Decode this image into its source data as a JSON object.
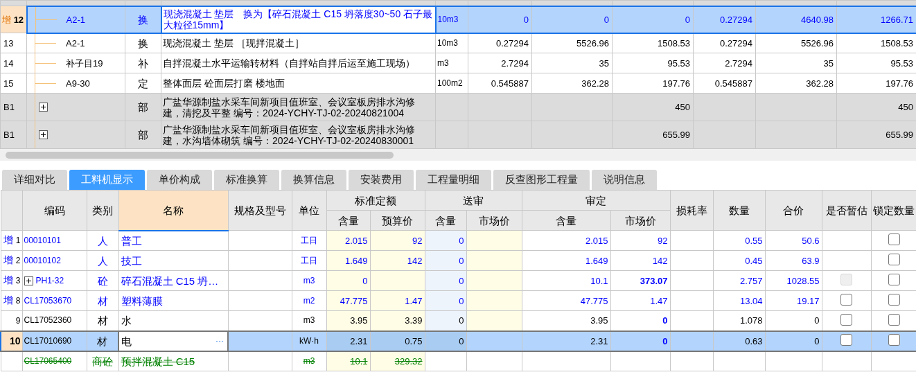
{
  "top_table": {
    "rows": [
      {
        "tag": "增",
        "num": "12",
        "kind": "item",
        "code": "A2-1",
        "type": "换",
        "name": "现浇混凝土 垫层　换为【碎石混凝土 C15 坍落度30~50 石子最大粒径15mm】",
        "unit": "10m3",
        "values": {
          "c1": "0",
          "c2": "0",
          "c3": "0",
          "c4": "0.27294",
          "c5": "4640.98",
          "c6": "1266.71"
        },
        "selected": true
      },
      {
        "num": "13",
        "kind": "item",
        "code": "A2-1",
        "type": "换",
        "name": "现浇混凝土 垫层 ［现拌混凝土］",
        "unit": "10m3",
        "values": {
          "c1": "0.27294",
          "c2": "5526.96",
          "c3": "1508.53",
          "c4": "0.27294",
          "c5": "5526.96",
          "c6": "1508.53"
        },
        "selected": false
      },
      {
        "num": "14",
        "kind": "item",
        "code": "补子目19",
        "type": "补",
        "name": "自拌混凝土水平运输转材料（自拌站自拌后运至施工现场）",
        "unit": "m3",
        "values": {
          "c1": "2.7294",
          "c2": "35",
          "c3": "95.53",
          "c4": "2.7294",
          "c5": "35",
          "c6": "95.53"
        },
        "selected": false
      },
      {
        "num": "15",
        "kind": "item",
        "code": "A9-30",
        "type": "定",
        "name": "整体面层 砼面层打磨 楼地面",
        "unit": "100m2",
        "values": {
          "c1": "0.545887",
          "c2": "362.28",
          "c3": "197.76",
          "c4": "0.545887",
          "c5": "362.28",
          "c6": "197.76"
        },
        "selected": false
      },
      {
        "num": "B1",
        "kind": "section",
        "type": "部",
        "name": "广盐华源制盐水采车间新项目值班室、会议室板房排水沟修建，清挖及平整 编号：2024-YCHY-TJ-02-20240821004",
        "values": {
          "c3": "450",
          "c6": "450"
        },
        "selected": false
      },
      {
        "num": "B1",
        "kind": "section",
        "type": "部",
        "name": "广盐华源制盐水采车间新项目值班室、会议室板房排水沟修建，水沟墙体砌筑 编号：2024-YCHY-TJ-02-20240830001",
        "values": {
          "c3": "655.99",
          "c6": "655.99"
        },
        "selected": false
      }
    ]
  },
  "tabs": [
    {
      "label": "详细对比",
      "selected": false
    },
    {
      "label": "工料机显示",
      "selected": true
    },
    {
      "label": "单价构成",
      "selected": false
    },
    {
      "label": "标准换算",
      "selected": false
    },
    {
      "label": "换算信息",
      "selected": false
    },
    {
      "label": "安装费用",
      "selected": false
    },
    {
      "label": "工程量明细",
      "selected": false
    },
    {
      "label": "反查图形工程量",
      "selected": false
    },
    {
      "label": "说明信息",
      "selected": false
    }
  ],
  "resource_table": {
    "columns": [
      {
        "label": "编码",
        "selected": false
      },
      {
        "label": "类别",
        "selected": false
      },
      {
        "label": "名称",
        "selected": true
      },
      {
        "label": "规格及型号",
        "selected": false
      },
      {
        "label": "单位",
        "selected": false
      },
      {
        "label": "标准定额",
        "selected": false,
        "children": [
          "含量",
          "预算价"
        ]
      },
      {
        "label": "送审",
        "selected": false,
        "children": [
          "含量",
          "市场价"
        ]
      },
      {
        "label": "审定",
        "selected": false,
        "children": [
          "含量",
          "市场价"
        ]
      },
      {
        "label": "损耗率",
        "selected": false
      },
      {
        "label": "数量",
        "selected": false
      },
      {
        "label": "合价",
        "selected": false
      },
      {
        "label": "是否暂估",
        "selected": false
      },
      {
        "label": "锁定数量",
        "selected": false
      }
    ],
    "rows": [
      {
        "kind": "added",
        "tag": "增",
        "num": "1",
        "code": "00010101",
        "expandable": false,
        "type": "人",
        "name": "普工",
        "unit": "工日",
        "std_qty": "2.015",
        "std_price": "92",
        "sub_qty": "0",
        "aud_qty": "2.015",
        "aud_price": "92",
        "price_changed": false,
        "qty": "0.55",
        "total": "50.6",
        "locked": {
          "checked": false
        },
        "selected": false
      },
      {
        "kind": "added",
        "tag": "增",
        "num": "2",
        "code": "00010102",
        "expandable": false,
        "type": "人",
        "name": "技工",
        "unit": "工日",
        "std_qty": "1.649",
        "std_price": "142",
        "sub_qty": "0",
        "aud_qty": "1.649",
        "aud_price": "142",
        "price_changed": false,
        "qty": "0.45",
        "total": "63.9",
        "locked": {
          "checked": false
        },
        "selected": false
      },
      {
        "kind": "added",
        "tag": "增",
        "num": "3",
        "code": "PH1-32",
        "expandable": true,
        "type": "砼",
        "name": "碎石混凝土 C15 坍…",
        "unit": "m3",
        "std_qty": "0",
        "sub_qty": "0",
        "aud_qty": "10.1",
        "aud_price": "373.07",
        "price_changed": true,
        "qty": "2.757",
        "total": "1028.55",
        "estimate": {
          "checked": false,
          "disabled": true
        },
        "locked": {
          "checked": false
        },
        "selected": false
      },
      {
        "kind": "added",
        "tag": "增",
        "num": "8",
        "code": "CL17053670",
        "expandable": false,
        "type": "材",
        "name": "塑料薄膜",
        "unit": "m2",
        "std_qty": "47.775",
        "std_price": "1.47",
        "sub_qty": "0",
        "aud_qty": "47.775",
        "aud_price": "1.47",
        "price_changed": false,
        "qty": "13.04",
        "total": "19.17",
        "estimate": {
          "checked": false,
          "disabled": false
        },
        "locked": {
          "checked": false
        },
        "selected": false
      },
      {
        "kind": "normal",
        "num": "9",
        "code": "CL17052360",
        "expandable": false,
        "type": "材",
        "name": "水",
        "unit": "m3",
        "std_qty": "3.95",
        "std_price": "3.39",
        "sub_qty": "0",
        "aud_qty": "3.95",
        "aud_price": "0",
        "price_changed": true,
        "qty": "1.078",
        "total": "0",
        "estimate": {
          "checked": false,
          "disabled": false
        },
        "locked": {
          "checked": false
        },
        "selected": false
      },
      {
        "kind": "normal",
        "num": "10",
        "code": "CL17010690",
        "expandable": false,
        "type": "材",
        "name": "电",
        "name_button": "···",
        "unit": "kW·h",
        "std_qty": "2.31",
        "std_price": "0.75",
        "sub_qty": "0",
        "aud_qty": "2.31",
        "aud_price": "0",
        "price_changed": true,
        "qty": "0.63",
        "total": "0",
        "estimate": {
          "checked": false,
          "disabled": false
        },
        "locked": {
          "checked": false
        },
        "selected": true
      },
      {
        "kind": "removed",
        "code": "CL17065400",
        "expandable": false,
        "type": "商砼",
        "name": "预拌混凝土 C15",
        "unit": "m3",
        "std_qty": "10.1",
        "std_price": "329.32",
        "selected": false
      }
    ]
  }
}
